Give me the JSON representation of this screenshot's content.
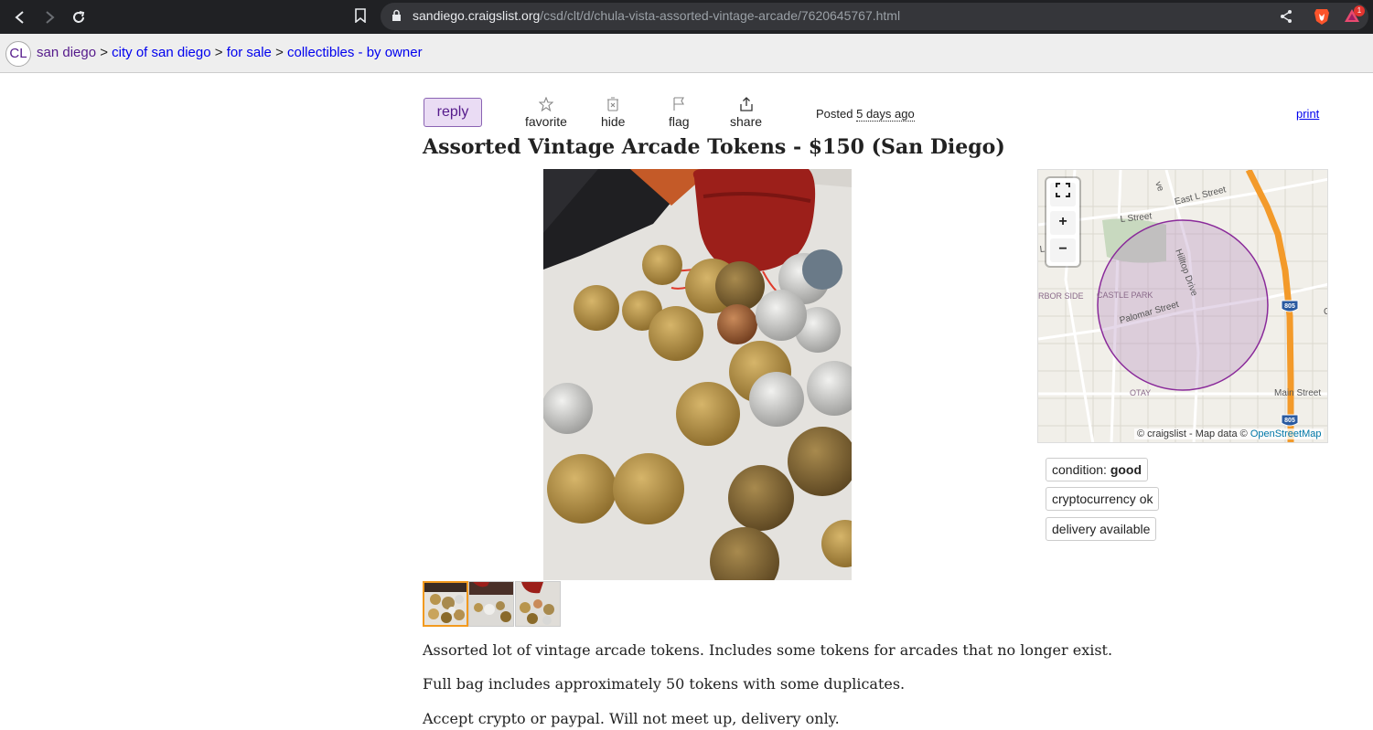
{
  "browser": {
    "url_host": "sandiego.craigslist.org",
    "url_path": "/csd/clt/d/chula-vista-assorted-vintage-arcade/7620645767.html",
    "notification_count": "1"
  },
  "breadcrumb": {
    "logo": "CL",
    "items": [
      "san diego",
      "city of san diego",
      "for sale",
      "collectibles - by owner"
    ],
    "separator": ">"
  },
  "actions": {
    "reply": "reply",
    "favorite": "favorite",
    "hide": "hide",
    "flag": "flag",
    "share": "share",
    "posted_label": "Posted",
    "posted_ago": "5 days ago",
    "print": "print"
  },
  "post": {
    "title": "Assorted Vintage Arcade Tokens - $150 (San Diego)",
    "body": [
      "Assorted lot of vintage arcade tokens. Includes some tokens for arcades that no longer exist.",
      "Full bag includes approximately 50 tokens with some duplicates.",
      "Accept crypto or paypal. Will not meet up, delivery only."
    ]
  },
  "attributes": {
    "condition_label": "condition:",
    "condition_value": "good",
    "crypto": "cryptocurrency ok",
    "delivery": "delivery available"
  },
  "map": {
    "attribution_prefix": "© craigslist - Map data ©",
    "attribution_link": "OpenStreetMap",
    "zoom_in": "+",
    "zoom_out": "−",
    "labels": {
      "east_l": "East L Street",
      "l_street": "L Street",
      "hilltop": "Hilltop Drive",
      "castle_park": "CASTLE PARK",
      "palomar": "Palomar Street",
      "harbor_side": "RBOR SIDE",
      "otay": "OTAY",
      "main": "Main Street",
      "i805": "805",
      "l_s": "L S",
      "ve": "ve",
      "c": "C"
    }
  },
  "colors": {
    "link": "#0000ee",
    "visited": "#551a8b",
    "reply_bg": "#eadcf4",
    "thumb_active": "#f29a1f",
    "freeway": "#f39a2a",
    "radius": "#8a2a9a"
  }
}
